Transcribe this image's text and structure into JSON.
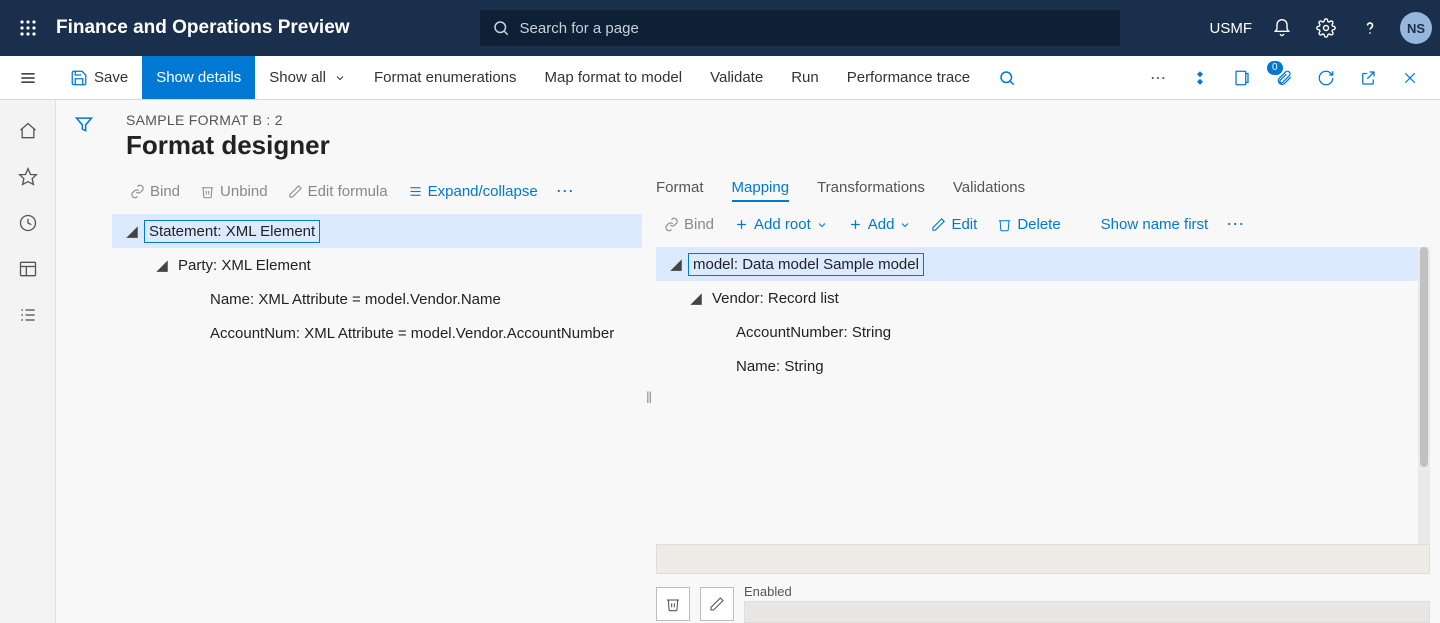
{
  "app_title": "Finance and Operations Preview",
  "search_placeholder": "Search for a page",
  "company": "USMF",
  "avatar_initials": "NS",
  "cmd": {
    "save": "Save",
    "show_details": "Show details",
    "show_all": "Show all",
    "format_enums": "Format enumerations",
    "map_format": "Map format to model",
    "validate": "Validate",
    "run": "Run",
    "perf_trace": "Performance trace"
  },
  "attach_badge": "0",
  "breadcrumb": "SAMPLE FORMAT B : 2",
  "page_title": "Format designer",
  "left_toolbar": {
    "bind": "Bind",
    "unbind": "Unbind",
    "edit_formula": "Edit formula",
    "expand": "Expand/collapse"
  },
  "format_tree": {
    "root": "Statement: XML Element",
    "party": "Party: XML Element",
    "name_attr": "Name: XML Attribute = model.Vendor.Name",
    "accountnum_attr": "AccountNum: XML Attribute = model.Vendor.AccountNumber"
  },
  "tabs": {
    "format": "Format",
    "mapping": "Mapping",
    "transformations": "Transformations",
    "validations": "Validations"
  },
  "right_toolbar": {
    "bind": "Bind",
    "add_root": "Add root",
    "add": "Add",
    "edit": "Edit",
    "delete": "Delete",
    "show_name_first": "Show name first"
  },
  "mapping_tree": {
    "root": "model: Data model Sample model",
    "vendor": "Vendor: Record list",
    "accountnumber": "AccountNumber: String",
    "name": "Name: String"
  },
  "enabled_label": "Enabled"
}
